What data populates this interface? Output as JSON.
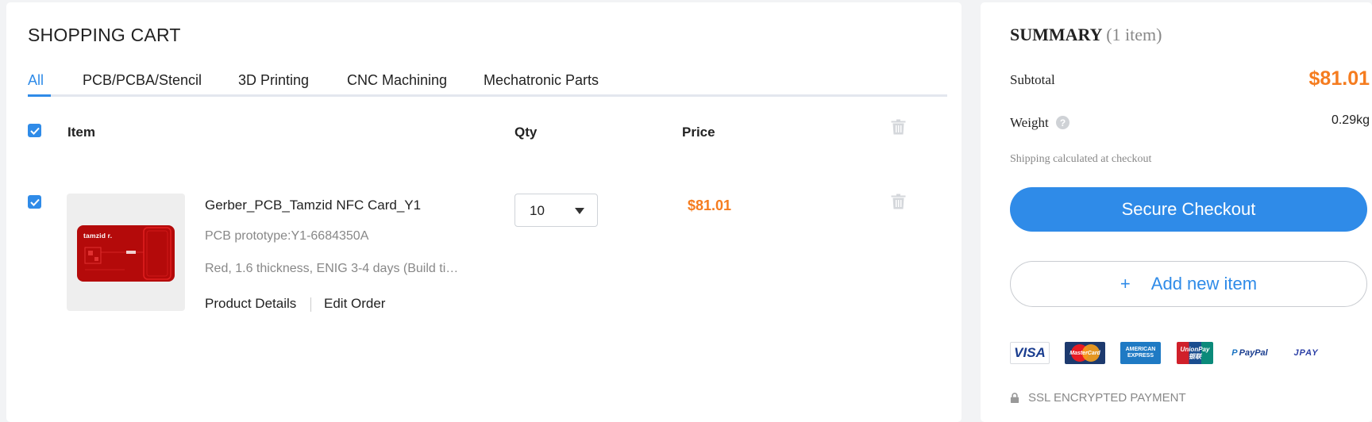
{
  "cart": {
    "title": "SHOPPING CART",
    "tabs": [
      {
        "label": "All",
        "active": true
      },
      {
        "label": "PCB/PCBA/Stencil",
        "active": false
      },
      {
        "label": "3D Printing",
        "active": false
      },
      {
        "label": "CNC Machining",
        "active": false
      },
      {
        "label": "Mechatronic Parts",
        "active": false
      }
    ],
    "columns": {
      "item": "Item",
      "qty": "Qty",
      "price": "Price"
    },
    "select_all_checked": true,
    "items": [
      {
        "checked": true,
        "thumbnail_text": "tamzid r.",
        "name": "Gerber_PCB_Tamzid NFC Card_Y1",
        "subtitle": "PCB prototype:Y1-6684350A",
        "specs": "Red, 1.6 thickness, ENIG 3-4 days (Build ti…",
        "product_details_link": "Product Details",
        "edit_order_link": "Edit Order",
        "qty": "10",
        "price": "$81.01"
      }
    ]
  },
  "summary": {
    "title": "SUMMARY",
    "count": "(1 item)",
    "subtotal_label": "Subtotal",
    "subtotal_value": "$81.01",
    "weight_label": "Weight",
    "weight_help": "?",
    "weight_value": "0.29kg",
    "shipping_note": "Shipping calculated at checkout",
    "checkout_label": "Secure Checkout",
    "add_plus": "+",
    "add_label": "Add new item",
    "payments": [
      "VISA",
      "MasterCard",
      "AMERICAN EXPRESS",
      "UnionPay 银联",
      "PayPal",
      "JPAY"
    ],
    "ssl_text": "SSL ENCRYPTED PAYMENT"
  },
  "colors": {
    "accent": "#2f8be8",
    "price": "#f57c1f",
    "pcb": "#b40a0a"
  }
}
